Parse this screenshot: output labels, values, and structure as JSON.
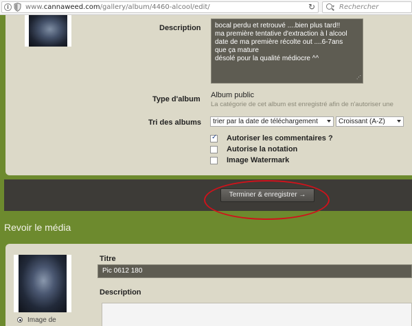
{
  "browser": {
    "url_prefix": "www.",
    "url_domain": "cannaweed.com",
    "url_path": "/gallery/album/4460-alcool/edit/",
    "search_placeholder": "Rechercher",
    "icons": [
      "info-icon",
      "shield-icon",
      "reload-icon",
      "search-icon"
    ]
  },
  "album_form": {
    "description_label": "Description",
    "description_value": "bocal perdu et retrouvé ....bien plus tard!!\nma première tentative d'extraction à l alcool\ndate de ma première récolte out ....6-7ans\nque ça mature\ndésolé pour la qualité médiocre ^^",
    "type_label": "Type d'album",
    "type_value": "Album public",
    "type_note": "La catégorie de cet album est enregistré afin de n'autoriser une",
    "sort_label": "Tri des albums",
    "sort_value": "trier par la date de téléchargement",
    "order_value": "Croissant (A-Z)",
    "checkboxes": [
      {
        "label": "Autoriser les commentaires ?",
        "checked": true
      },
      {
        "label": "Autorise la notation",
        "checked": false
      },
      {
        "label": "Image Watermark",
        "checked": false
      }
    ]
  },
  "submit_button_label": "Terminer & enregistrer →",
  "review": {
    "section_title": "Revoir le média",
    "titre_label": "Titre",
    "titre_value": "Pic 0612 180",
    "description_label": "Description",
    "radio_label": "Image de"
  },
  "colors": {
    "page_bg": "#6d8a2e",
    "panel_bg": "#dcd9c8",
    "field_bg": "#5e5c52",
    "submit_bar_bg": "#3d3b37",
    "annotation_red": "#d0121b"
  }
}
